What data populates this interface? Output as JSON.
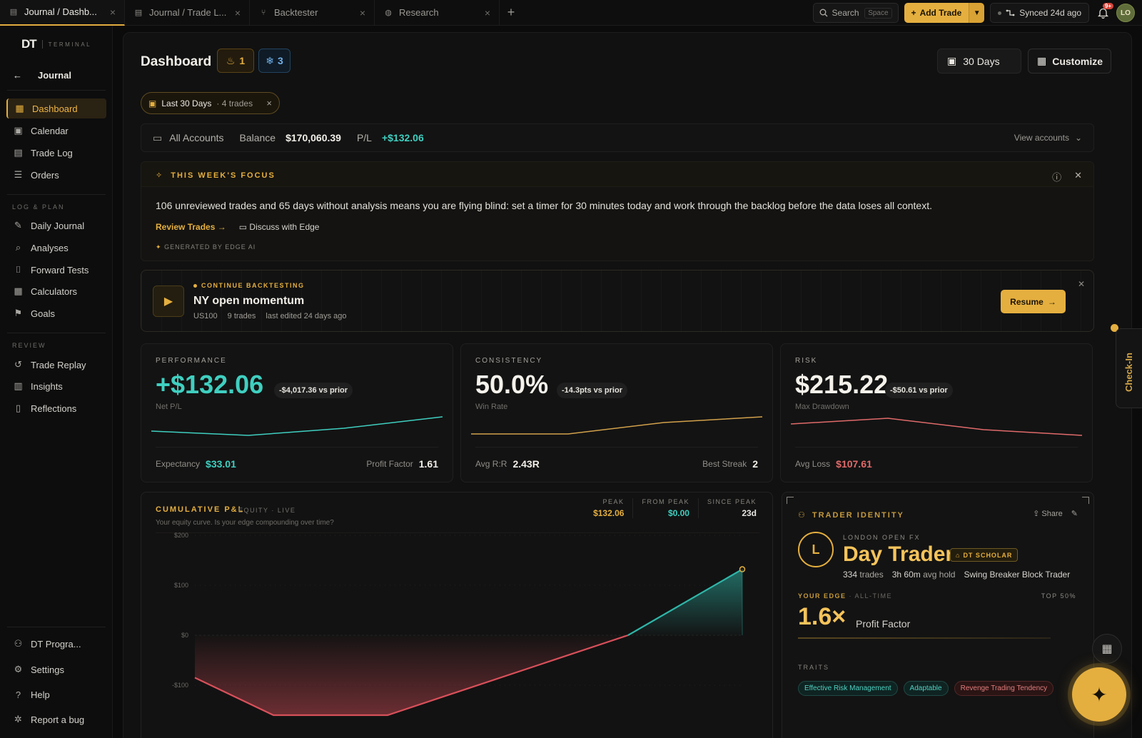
{
  "tabs": [
    {
      "label": "Journal / Dashb...",
      "icon": "journal-icon",
      "active": true
    },
    {
      "label": "Journal / Trade L...",
      "icon": "journal-icon",
      "active": false
    },
    {
      "label": "Backtester",
      "icon": "backtester-icon",
      "active": false
    },
    {
      "label": "Research",
      "icon": "globe-icon",
      "active": false
    }
  ],
  "topbar": {
    "search_label": "Search",
    "search_shortcut": "Space",
    "add_trade_label": "Add Trade",
    "synced_label": "Synced 24d ago",
    "notifications_count": "9+",
    "avatar_initials": "LO"
  },
  "sidebar": {
    "brand_logo": "DT",
    "brand_tag": "TERMINAL",
    "back_label": "Journal",
    "primary": [
      {
        "label": "Dashboard",
        "icon": "dashboard-icon",
        "active": true
      },
      {
        "label": "Calendar",
        "icon": "calendar-icon"
      },
      {
        "label": "Trade Log",
        "icon": "trade-log-icon"
      },
      {
        "label": "Orders",
        "icon": "orders-icon"
      }
    ],
    "log_plan_label": "LOG & PLAN",
    "log_plan": [
      {
        "label": "Daily Journal",
        "icon": "pen-icon"
      },
      {
        "label": "Analyses",
        "icon": "analyses-icon"
      },
      {
        "label": "Forward Tests",
        "icon": "forward-test-icon"
      },
      {
        "label": "Calculators",
        "icon": "calculator-icon"
      },
      {
        "label": "Goals",
        "icon": "flag-icon"
      }
    ],
    "review_label": "REVIEW",
    "review": [
      {
        "label": "Trade Replay",
        "icon": "history-icon"
      },
      {
        "label": "Insights",
        "icon": "bar-chart-icon"
      },
      {
        "label": "Reflections",
        "icon": "document-icon"
      }
    ],
    "bottom": [
      {
        "label": "DT Progra...",
        "icon": "users-icon"
      },
      {
        "label": "Settings",
        "icon": "gear-icon"
      },
      {
        "label": "Help",
        "icon": "help-icon"
      },
      {
        "label": "Report a bug",
        "icon": "bug-icon"
      }
    ]
  },
  "header": {
    "title": "Dashboard",
    "streak_fire": "1",
    "streak_freeze": "3",
    "range_button": "30 Days",
    "customize_button": "Customize"
  },
  "filter_chip": {
    "label": "Last 30 Days",
    "sub": "· 4 trades"
  },
  "accounts": {
    "label": "All Accounts",
    "balance_label": "Balance",
    "balance_value": "$170,060.39",
    "pl_label": "P/L",
    "pl_value": "+$132.06",
    "view_label": "View accounts"
  },
  "focus": {
    "heading": "THIS WEEK'S FOCUS",
    "text": "106 unreviewed trades and 65 days without analysis means you are flying blind: set a timer for 30 minutes today and work through the backlog before the data loses all context.",
    "review_label": "Review Trades",
    "discuss_label": "Discuss with Edge",
    "generated_label": "GENERATED BY EDGE AI"
  },
  "backtest": {
    "label": "CONTINUE BACKTESTING",
    "title": "NY open momentum",
    "symbol": "US100",
    "trades": "9 trades",
    "edited": "last edited 24 days ago",
    "resume_label": "Resume"
  },
  "cards": {
    "performance": {
      "label": "PERFORMANCE",
      "value": "+$132.06",
      "delta": "-$4,017.36 vs prior",
      "sub": "Net P/L",
      "foot_left_label": "Expectancy",
      "foot_left_value": "$33.01",
      "foot_right_label": "Profit Factor",
      "foot_right_value": "1.61",
      "color": "#3fcfc0"
    },
    "consistency": {
      "label": "CONSISTENCY",
      "value": "50.0%",
      "delta": "-14.3pts vs prior",
      "sub": "Win Rate",
      "foot_left_label": "Avg R:R",
      "foot_left_value": "2.43R",
      "foot_right_label": "Best Streak",
      "foot_right_value": "2",
      "color": "#d2a14b"
    },
    "risk": {
      "label": "RISK",
      "value": "$215.22",
      "delta": "-$50.61 vs prior",
      "sub": "Max Drawdown",
      "foot_left_label": "Avg Loss",
      "foot_left_value": "$107.61",
      "color": "#e06a6a"
    }
  },
  "pnl": {
    "heading": "CUMULATIVE P&L",
    "tag": "EQUITY · LIVE",
    "sub": "Your equity curve. Is your edge compounding over time?",
    "stats": [
      {
        "label": "PEAK",
        "value": "$132.06",
        "color": "#e5af3f"
      },
      {
        "label": "FROM PEAK",
        "value": "$0.00",
        "color": "#3fcfc0"
      },
      {
        "label": "SINCE PEAK",
        "value": "23d",
        "color": "#e8e6e1"
      }
    ]
  },
  "chart_data": {
    "type": "area",
    "title": "CUMULATIVE P&L",
    "y_ticks": [
      "$200",
      "$100",
      "$0",
      "-$100"
    ],
    "ylim": [
      -160,
      200
    ],
    "series": [
      {
        "values": [
          -85,
          -160,
          -160,
          0,
          132.06
        ]
      }
    ],
    "positive_color": "#2fb6a8",
    "negative_color": "#d8505a",
    "grid": true
  },
  "identity": {
    "heading": "TRADER IDENTITY",
    "share_label": "Share",
    "initial": "L",
    "subtitle": "LONDON OPEN FX",
    "title": "Day Trader",
    "scholar_badge": "DT SCHOLAR",
    "trades": "334",
    "trades_label": "trades",
    "hold": "3h 60m",
    "hold_label": "avg hold",
    "style": "Swing Breaker Block Trader",
    "edge_label": "YOUR EDGE",
    "edge_period": "· ALL-TIME",
    "top_label": "TOP 50%",
    "edge_value": "1.6×",
    "edge_name": "Profit Factor",
    "traits_label": "TRAITS",
    "traits": [
      {
        "label": "Effective Risk Management",
        "kind": "good"
      },
      {
        "label": "Adaptable",
        "kind": "good"
      },
      {
        "label": "Revenge Trading Tendency",
        "kind": "bad"
      }
    ]
  },
  "checkin_label": "Check-In"
}
